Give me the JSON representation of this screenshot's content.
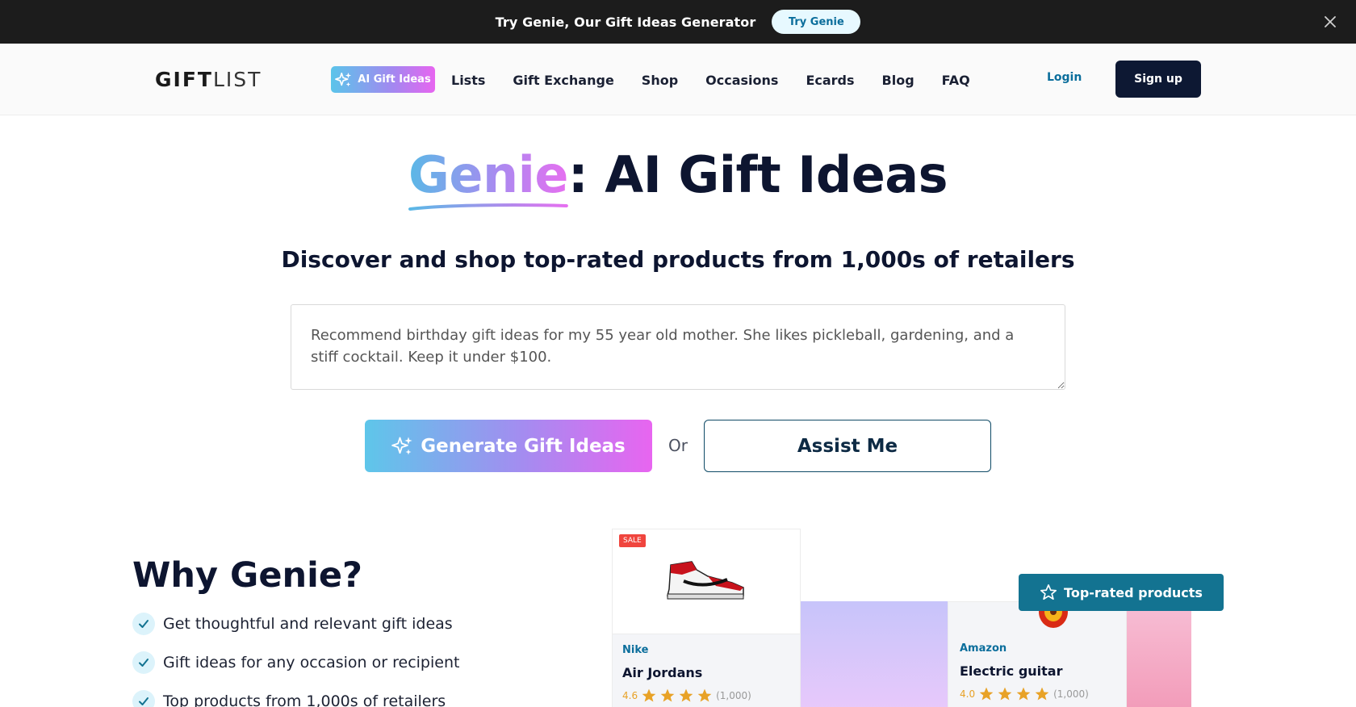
{
  "announcement": {
    "text": "Try Genie, Our Gift Ideas Generator",
    "button_label": "Try Genie",
    "close_icon": "close-icon"
  },
  "navbar": {
    "logo_bold": "GIFT",
    "logo_light": "LIST",
    "ai_button_label": "AI Gift Ideas",
    "links": [
      "Lists",
      "Gift Exchange",
      "Shop",
      "Occasions",
      "Ecards",
      "Blog",
      "FAQ"
    ],
    "login_label": "Login",
    "signup_label": "Sign up"
  },
  "hero": {
    "title_highlight": "Genie",
    "title_rest": ": AI Gift Ideas",
    "subtitle": "Discover and shop top-rated products from 1,000s of retailers",
    "prompt_value": "Recommend birthday gift ideas for my 55 year old mother. She likes pickleball, gardening, and a stiff cocktail. Keep it under $100.",
    "generate_label": "Generate Gift Ideas",
    "or_label": "Or",
    "assist_label": "Assist Me"
  },
  "why": {
    "title": "Why Genie?",
    "features": [
      "Get thoughtful and relevant gift ideas",
      "Gift ideas for any occasion or recipient",
      "Top products from 1,000s of retailers"
    ]
  },
  "showcase": {
    "badge_label": "Top-rated products",
    "cards": [
      {
        "sale": "SALE",
        "retailer": "Nike",
        "name": "Air Jordans",
        "rating": "4.6",
        "count": "(1,000)"
      },
      {
        "retailer": "Amazon",
        "name": "Electric guitar",
        "rating": "4.0",
        "count": "(1,000)"
      }
    ]
  },
  "colors": {
    "brand_dark": "#0d1833",
    "accent_teal": "#137391",
    "gradient_start": "#5ec6ea",
    "gradient_end": "#e865f0",
    "star": "#e8a227"
  }
}
